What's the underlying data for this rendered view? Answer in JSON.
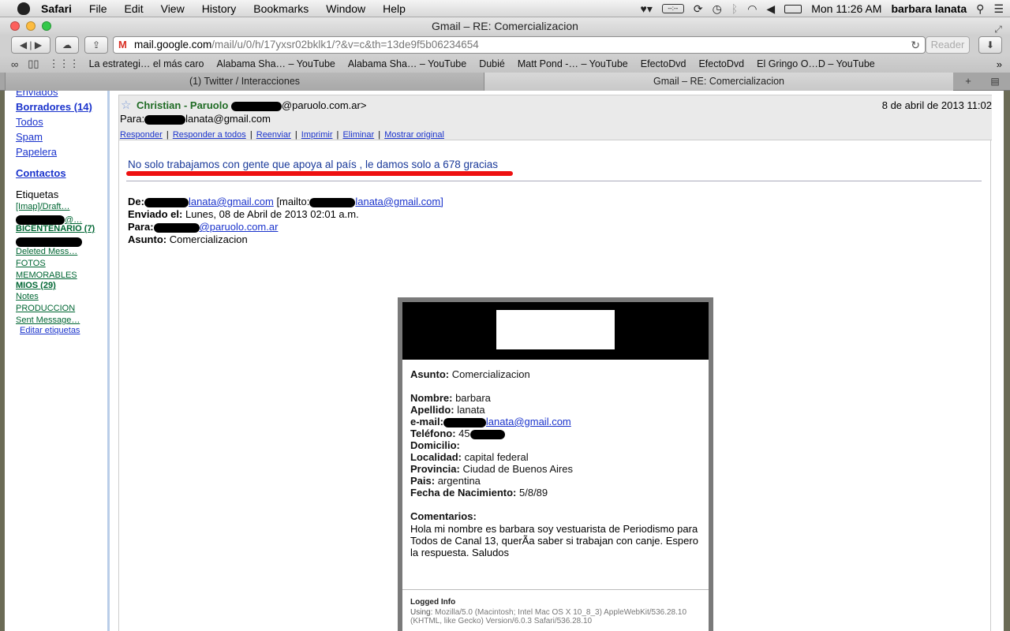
{
  "menubar": {
    "app": "Safari",
    "items": [
      "File",
      "Edit",
      "View",
      "History",
      "Bookmarks",
      "Window",
      "Help"
    ],
    "clock": "Mon 11:26 AM",
    "user": "barbara lanata"
  },
  "window": {
    "title": "Gmail – RE: Comercializacion"
  },
  "toolbar": {
    "url_host": "mail.google.com",
    "url_path": "/mail/u/0/h/17yxsr02bklk1/?&v=c&th=13de9f5b06234654",
    "reader_label": "Reader"
  },
  "bookmarks": [
    "La estrategi… el más caro",
    "Alabama Sha… – YouTube",
    "Alabama Sha… – YouTube",
    "Dubié",
    "Matt Pond -… – YouTube",
    "EfectoDvd",
    "EfectoDvd",
    "El Gringo O…D – YouTube"
  ],
  "tabs": [
    {
      "label": "(1) Twitter / Interacciones"
    },
    {
      "label": "Gmail – RE: Comercializacion"
    }
  ],
  "leftnav": {
    "enviados": "Enviados",
    "borradores": "Borradores (14)",
    "todos": "Todos",
    "spam": "Spam",
    "papelera": "Papelera",
    "contactos": "Contactos",
    "etiquetas": "Etiquetas",
    "labels": {
      "imap": "[Imap]/Draft…",
      "redacted1": "@…",
      "bicentenario": "BICENTENARIO (7)",
      "deleted": "Deleted Mess…",
      "fotos": "FOTOS",
      "memorables": "MEMORABLES",
      "mios": "MIOS (29)",
      "notes": "Notes",
      "produccion": "PRODUCCION",
      "sent": "Sent Message…"
    },
    "edit_labels": "Editar etiquetas"
  },
  "mail": {
    "sender_name": "Christian - Paruolo",
    "sender_addr_suffix": "@paruolo.com.ar>",
    "date": "8 de abril de 2013 11:02",
    "para_label": "Para:",
    "para_suffix": "lanata@gmail.com",
    "actions": [
      "Responder",
      "Responder a todos",
      "Reenviar",
      "Imprimir",
      "Eliminar",
      "Mostrar original"
    ],
    "headline": "No solo trabajamos con gente que apoya al país  , le damos solo a 678 gracias",
    "fwd": {
      "de_label": "De:",
      "de_link": "lanata@gmail.com",
      "mailto_prefix": "[mailto:",
      "mailto_suffix": "lanata@gmail.com]",
      "enviado_label": "Enviado el:",
      "enviado_value": "Lunes, 08 de Abril de 2013 02:01 a.m.",
      "para_label": "Para:",
      "para_link": "@paruolo.com.ar",
      "asunto_label": "Asunto:",
      "asunto_value": "Comercializacion"
    },
    "card": {
      "asunto_label": "Asunto:",
      "asunto_value": "Comercializacion",
      "nombre_label": "Nombre:",
      "nombre_value": "barbara",
      "apellido_label": "Apellido:",
      "apellido_value": "lanata",
      "email_label": "e-mail:",
      "email_link": "lanata@gmail.com",
      "telefono_label": "Teléfono:",
      "telefono_value": "45",
      "domicilio_label": "Domicilio:",
      "localidad_label": "Localidad:",
      "localidad_value": "capital federal",
      "provincia_label": "Provincia:",
      "provincia_value": "Ciudad de Buenos Aires",
      "pais_label": "Pais:",
      "pais_value": "argentina",
      "nacimiento_label": "Fecha de Nacimiento:",
      "nacimiento_value": "5/8/89",
      "comentarios_label": "Comentarios:",
      "comentarios_value": "Hola mi nombre es barbara soy vestuarista de Periodismo para Todos de Canal 13, querÃa saber si trabajan con canje. Espero la respuesta. Saludos",
      "logged_info": "Logged Info",
      "using_label": "Using:",
      "using_value": "Mozilla/5.0 (Macintosh; Intel Mac OS X 10_8_3) AppleWebKit/536.28.10 (KHTML, like Gecko) Version/6.0.3 Safari/536.28.10"
    }
  },
  "colors": {
    "accent_link": "#1a33cc",
    "label_green": "#006633",
    "sender_green": "#1f6b24",
    "headline_blue": "#1a3a9a",
    "redline": "#ee1111"
  }
}
